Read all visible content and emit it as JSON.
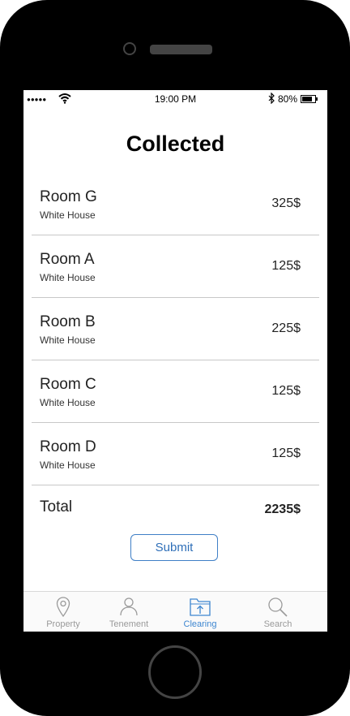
{
  "status_bar": {
    "signal": "●●●●●",
    "time": "19:00 PM",
    "battery_percent": "80%",
    "battery_level": 0.8
  },
  "page": {
    "title": "Collected"
  },
  "rows": [
    {
      "room": "Room G",
      "building": "White House",
      "amount": "325$"
    },
    {
      "room": "Room A",
      "building": "White House",
      "amount": "125$"
    },
    {
      "room": "Room B",
      "building": "White House",
      "amount": "225$"
    },
    {
      "room": "Room C",
      "building": "White House",
      "amount": "125$"
    },
    {
      "room": "Room D",
      "building": "White House",
      "amount": "125$"
    }
  ],
  "total": {
    "label": "Total",
    "amount": "2235$"
  },
  "actions": {
    "submit_label": "Submit"
  },
  "tabs": [
    {
      "label": "Property",
      "icon": "location-pin-icon",
      "active": false
    },
    {
      "label": "Tenement",
      "icon": "person-icon",
      "active": false
    },
    {
      "label": "Clearing",
      "icon": "folder-upload-icon",
      "active": true
    },
    {
      "label": "Search",
      "icon": "search-icon",
      "active": false
    }
  ],
  "colors": {
    "accent": "#3d86d0",
    "inactive": "#9a9a9a",
    "phone_body": "#000000"
  }
}
